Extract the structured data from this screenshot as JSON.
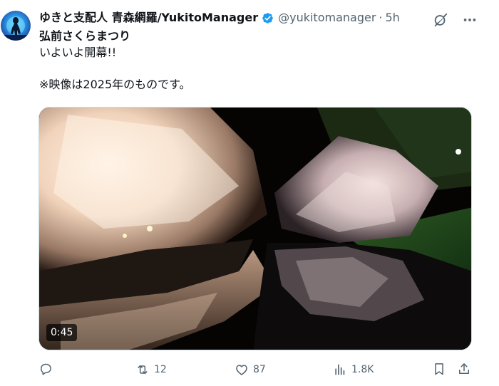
{
  "post": {
    "display_name": "ゆきと支配人 青森網羅/YukitoManager",
    "handle": "@yukitomanager",
    "separator": "·",
    "time": "5h",
    "text_lines": [
      "弘前さくらまつり",
      "いよいよ開幕!!",
      "",
      "※映像は2025年のものです。"
    ]
  },
  "media": {
    "duration": "0:45"
  },
  "actions": {
    "reply_count": "",
    "repost_count": "12",
    "like_count": "87",
    "views_count": "1.8K"
  },
  "icons": {
    "verified": "verified-badge-icon",
    "grok": "grok-icon",
    "more": "more-icon",
    "reply": "reply-icon",
    "repost": "repost-icon",
    "like": "like-icon",
    "views": "views-icon",
    "bookmark": "bookmark-icon",
    "share": "share-icon"
  },
  "colors": {
    "text_primary": "#0f1419",
    "text_secondary": "#536471",
    "verified_blue": "#1d9bf0",
    "border": "#cfd9de"
  }
}
